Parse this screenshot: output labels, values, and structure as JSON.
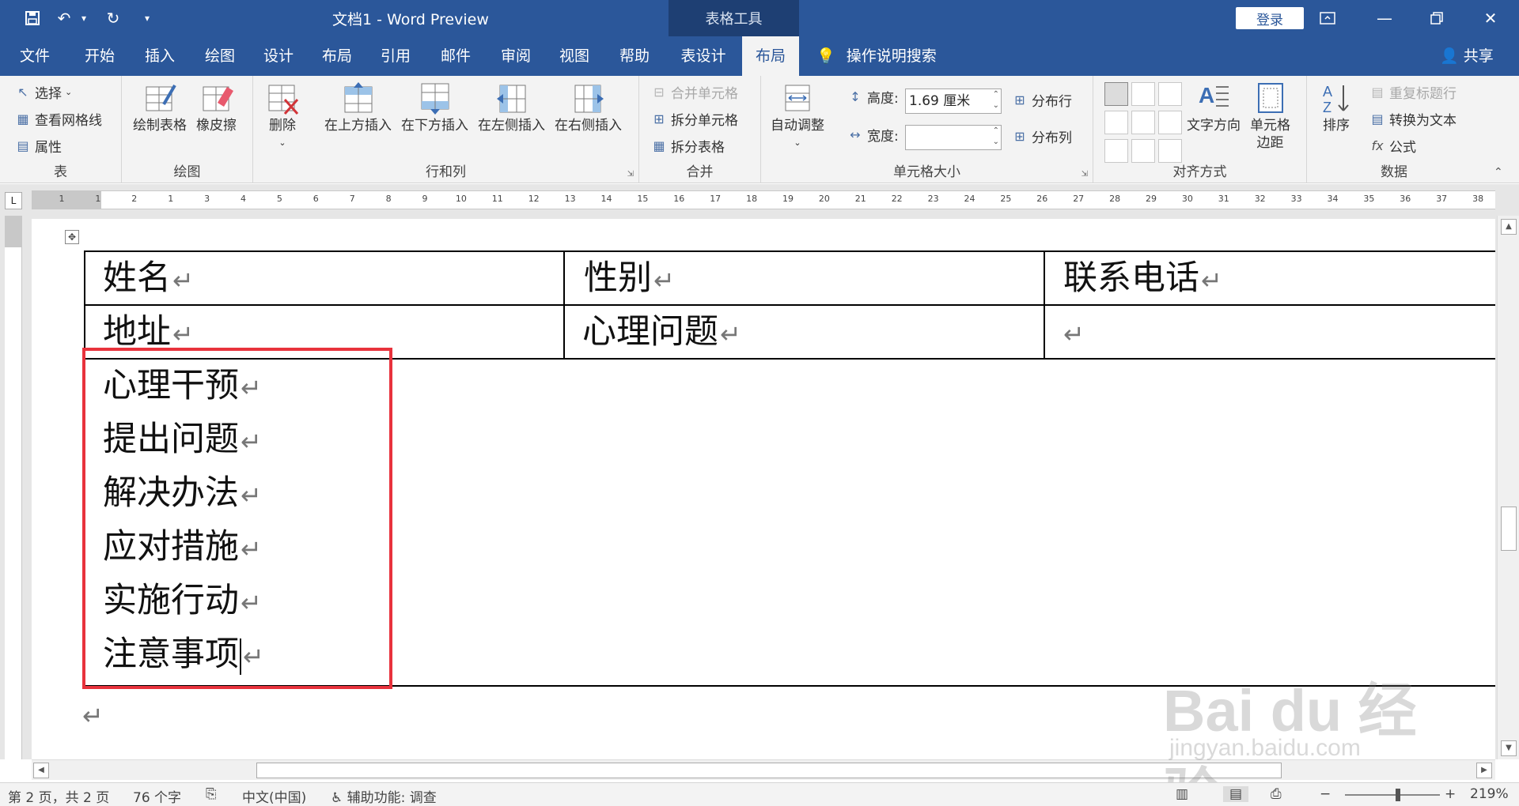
{
  "titlebar": {
    "doc_title": "文档1  -  Word Preview",
    "tool_tab": "表格工具",
    "login": "登录",
    "qa_more": "▾"
  },
  "tabs": [
    "文件",
    "开始",
    "插入",
    "绘图",
    "设计",
    "布局",
    "引用",
    "邮件",
    "审阅",
    "视图",
    "帮助",
    "表设计",
    "布局"
  ],
  "active_tab_index": 12,
  "search_label": "操作说明搜索",
  "share_label": "共享",
  "ribbon": {
    "table_group": {
      "label": "表",
      "select": "选择",
      "gridlines": "查看网格线",
      "properties": "属性"
    },
    "draw_group": {
      "label": "绘图",
      "draw_table": "绘制表格",
      "eraser": "橡皮擦"
    },
    "rows_cols_group": {
      "label": "行和列",
      "delete": "删除",
      "insert_above": "在上方插入",
      "insert_below": "在下方插入",
      "insert_left": "在左侧插入",
      "insert_right": "在右侧插入"
    },
    "merge_group": {
      "label": "合并",
      "merge_cells": "合并单元格",
      "split_cells": "拆分单元格",
      "split_table": "拆分表格"
    },
    "cell_size_group": {
      "label": "单元格大小",
      "autofit": "自动调整",
      "height_label": "高度:",
      "height_value": "1.69 厘米",
      "width_label": "宽度:",
      "width_value": "",
      "distribute_rows": "分布行",
      "distribute_cols": "分布列"
    },
    "alignment_group": {
      "label": "对齐方式",
      "text_direction": "文字方向",
      "cell_margins_1": "单元格",
      "cell_margins_2": "边距"
    },
    "data_group": {
      "label": "数据",
      "sort": "排序",
      "repeat_header": "重复标题行",
      "convert_text": "转换为文本",
      "formula": "公式"
    }
  },
  "ruler_ticks": [
    "1",
    "1",
    "2",
    "1",
    "3",
    "4",
    "5",
    "6",
    "7",
    "8",
    "9",
    "10",
    "11",
    "12",
    "13",
    "14",
    "15",
    "16",
    "17",
    "18",
    "19",
    "20",
    "21",
    "22",
    "23",
    "24",
    "25",
    "26",
    "27",
    "28",
    "29",
    "30",
    "31",
    "32",
    "33",
    "34",
    "35",
    "36",
    "37",
    "38"
  ],
  "document": {
    "row1": [
      "姓名",
      "性别",
      "联系电话"
    ],
    "row2": [
      "地址",
      "心理问题",
      ""
    ],
    "list": [
      "心理干预",
      "提出问题",
      "解决办法",
      "应对措施",
      "实施行动",
      "注意事项"
    ],
    "para_mark": "↵"
  },
  "statusbar": {
    "page": "第 2 页，共 2 页",
    "words": "76 个字",
    "language": "中文(中国)",
    "accessibility": "辅助功能: 调查",
    "zoom": "219%"
  },
  "watermark": {
    "line1": "Bai du 经验",
    "line2": "jingyan.baidu.com"
  },
  "colors": {
    "accent": "#2b579a",
    "highlight": "#e8323c"
  }
}
